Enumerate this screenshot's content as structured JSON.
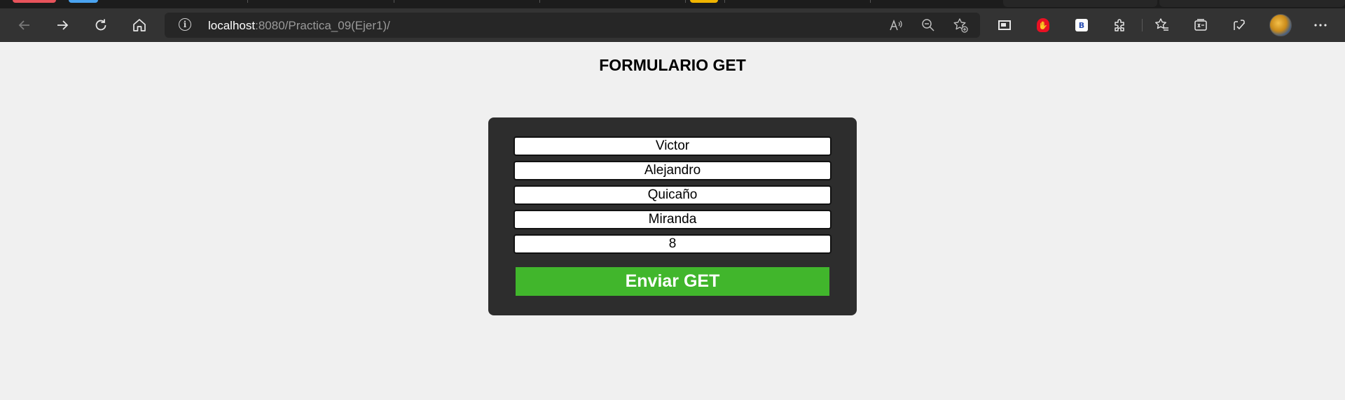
{
  "browser": {
    "url_host": "localhost",
    "url_path": ":8080/Practica_09(Ejer1)/",
    "icons": {
      "back": "back-arrow-icon",
      "forward": "forward-arrow-icon",
      "refresh": "refresh-icon",
      "home": "home-icon",
      "info": "site-info-icon",
      "read_aloud": "read-aloud-icon",
      "zoom": "zoom-out-icon",
      "favorite": "add-favorite-icon",
      "menu": "more-options-icon"
    },
    "extension_square_label": "B",
    "colors": {
      "toolbar": "#333333",
      "tabstrip": "#1c1c1c",
      "tab_red": "#e8535b",
      "tab_blue": "#4aa3f0",
      "tab_yellow": "#f0b400"
    }
  },
  "page": {
    "title": "FORMULARIO GET",
    "form": {
      "fields": [
        {
          "name": "first-name-field",
          "value": "Victor"
        },
        {
          "name": "middle-name-field",
          "value": "Alejandro"
        },
        {
          "name": "last-name-field",
          "value": "Quicaño"
        },
        {
          "name": "second-last-name-field",
          "value": "Miranda"
        },
        {
          "name": "number-field",
          "value": "8"
        }
      ],
      "submit_label": "Enviar GET"
    },
    "colors": {
      "background": "#f0f0f0",
      "card": "#2d2d2d",
      "button": "#41b62c"
    }
  }
}
